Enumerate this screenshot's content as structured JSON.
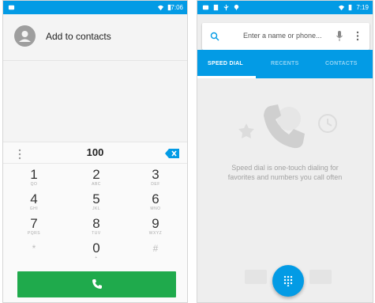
{
  "left_screen": {
    "status_bar": {
      "time": "7:06"
    },
    "add_contact": {
      "label": "Add to contacts"
    },
    "dialed_number": "100",
    "keys": [
      {
        "digit": "1",
        "letters": "QO"
      },
      {
        "digit": "2",
        "letters": "ABC"
      },
      {
        "digit": "3",
        "letters": "DEF"
      },
      {
        "digit": "4",
        "letters": "GHI"
      },
      {
        "digit": "5",
        "letters": "JKL"
      },
      {
        "digit": "6",
        "letters": "MNO"
      },
      {
        "digit": "7",
        "letters": "PQRS"
      },
      {
        "digit": "8",
        "letters": "TUV"
      },
      {
        "digit": "9",
        "letters": "WXYZ"
      },
      {
        "digit": "*",
        "letters": ""
      },
      {
        "digit": "0",
        "letters": "+"
      },
      {
        "digit": "#",
        "letters": ""
      }
    ],
    "colors": {
      "call_button": "#1faa4c",
      "status_bar": "#039be5"
    }
  },
  "right_screen": {
    "status_bar": {
      "time": "7:19"
    },
    "search": {
      "placeholder": "Enter a name or phone..."
    },
    "tabs": [
      {
        "label": "SPEED DIAL",
        "active": true
      },
      {
        "label": "RECENTS",
        "active": false
      },
      {
        "label": "CONTACTS",
        "active": false
      }
    ],
    "empty_state": {
      "line1": "Speed dial is one-touch dialing for",
      "line2": "favorites and numbers you call often"
    },
    "colors": {
      "accent": "#039be5"
    }
  }
}
